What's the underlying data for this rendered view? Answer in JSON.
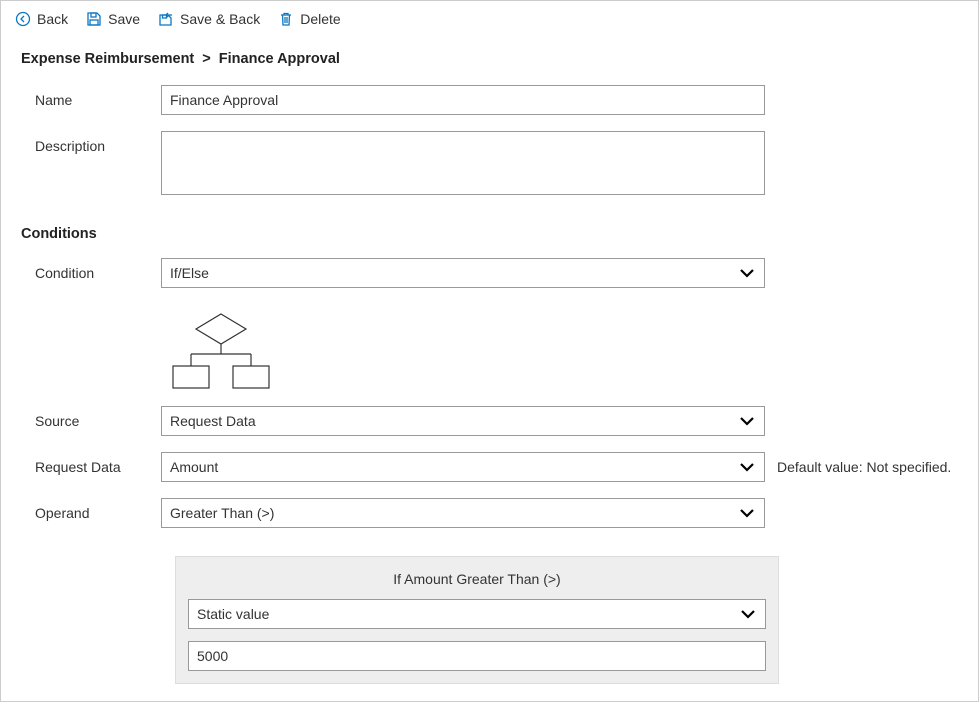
{
  "toolbar": {
    "back": "Back",
    "save": "Save",
    "save_and_back": "Save & Back",
    "delete": "Delete"
  },
  "breadcrumb": {
    "root": "Expense Reimbursement",
    "sep": ">",
    "current": "Finance Approval"
  },
  "form": {
    "name_label": "Name",
    "name_value": "Finance Approval",
    "description_label": "Description",
    "description_value": ""
  },
  "conditions": {
    "heading": "Conditions",
    "condition_label": "Condition",
    "condition_value": "If/Else",
    "source_label": "Source",
    "source_value": "Request Data",
    "request_data_label": "Request Data",
    "request_data_value": "Amount",
    "request_data_note": "Default value: Not specified.",
    "operand_label": "Operand",
    "operand_value": "Greater Than (>)",
    "panel_title": "If Amount Greater Than (>)",
    "value_source": "Static value",
    "static_value": "5000"
  }
}
